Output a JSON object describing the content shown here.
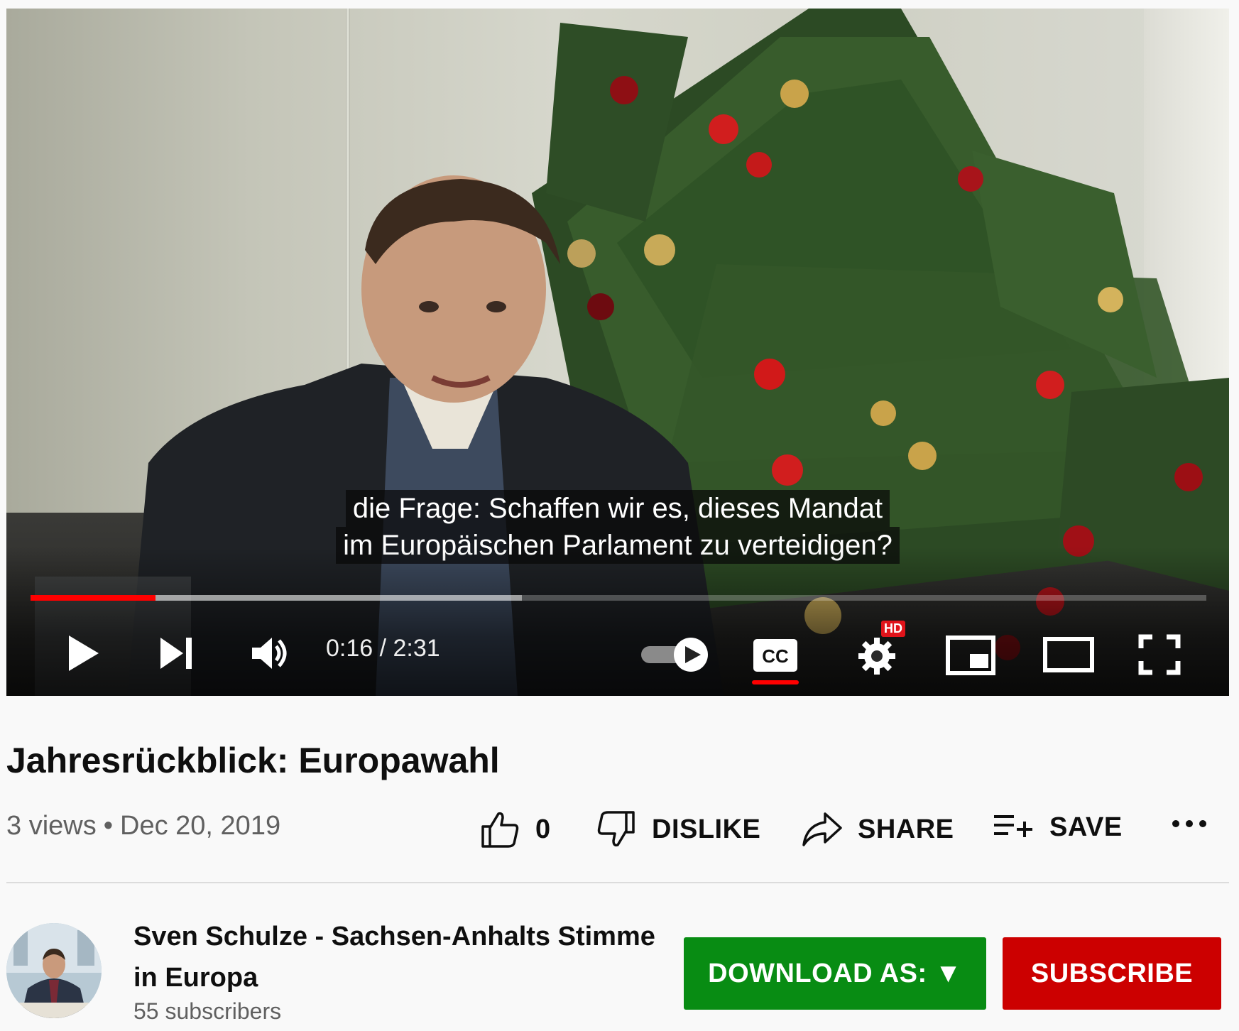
{
  "player": {
    "captions": [
      "die Frage: Schaffen wir es, dieses Mandat",
      "im Europäischen Parlament zu verteidigen?"
    ],
    "time_current": "0:16",
    "time_total": "2:31",
    "time_display": "0:16 / 2:31",
    "progress_played_fraction": 0.106,
    "progress_buffered_fraction": 0.418,
    "hd_badge": "HD",
    "accent_color": "#ff0000",
    "icons": [
      "play-icon",
      "next-icon",
      "volume-icon",
      "autoplay-toggle-icon",
      "captions-icon",
      "settings-icon",
      "miniplayer-icon",
      "theater-mode-icon",
      "fullscreen-icon"
    ]
  },
  "video": {
    "title": "Jahresrückblick: Europawahl",
    "views": "3 views",
    "separator": "•",
    "date": "Dec 20, 2019"
  },
  "actions": {
    "like_count": "0",
    "dislike_label": "DISLIKE",
    "share_label": "SHARE",
    "save_label": "SAVE",
    "icons": [
      "thumbs-up-icon",
      "thumbs-down-icon",
      "share-icon",
      "playlist-add-icon",
      "more-icon"
    ]
  },
  "channel": {
    "name": "Sven Schulze - Sachsen-Anhalts Stimme in Europa",
    "subscribers": "55 subscribers"
  },
  "buttons": {
    "download_label": "DOWNLOAD AS: ▼",
    "download_color": "#088c13",
    "subscribe_label": "SUBSCRIBE",
    "subscribe_color": "#cc0000"
  }
}
